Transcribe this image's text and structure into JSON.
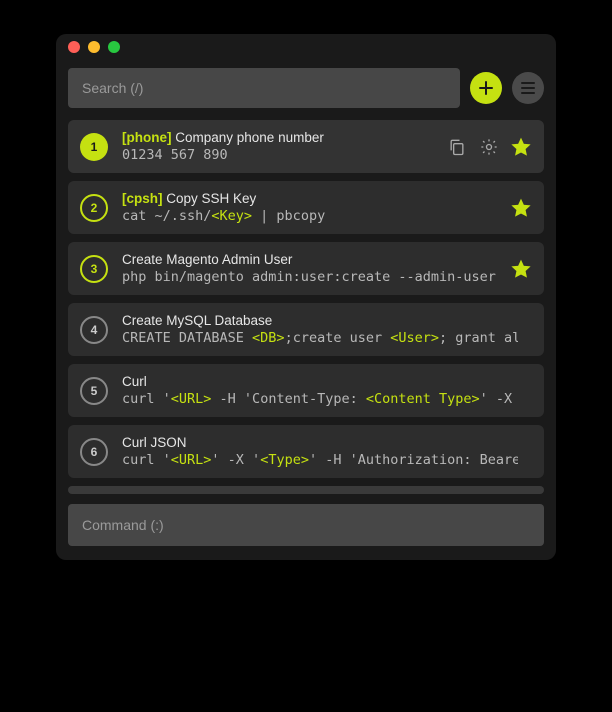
{
  "colors": {
    "accent": "#c5e111"
  },
  "search": {
    "placeholder": "Search (/)"
  },
  "command": {
    "placeholder": "Command (:)"
  },
  "items": [
    {
      "index": "1",
      "selected": true,
      "tag": "[phone]",
      "title": "Company phone number",
      "command": [
        {
          "t": "01234 567 890"
        }
      ],
      "starred": true,
      "showTools": true
    },
    {
      "index": "2",
      "selected": false,
      "tag": "[cpsh]",
      "title": "Copy SSH Key",
      "command": [
        {
          "t": "cat ~/.ssh/"
        },
        {
          "ph": "<Key>"
        },
        {
          "t": " | pbcopy"
        }
      ],
      "starred": true,
      "showTools": false
    },
    {
      "index": "3",
      "selected": false,
      "tag": "",
      "title": "Create Magento Admin User",
      "command": [
        {
          "t": "php bin/magento admin:user:create --admin-user="
        }
      ],
      "starred": true,
      "showTools": false
    },
    {
      "index": "4",
      "selected": false,
      "tag": "",
      "title": "Create MySQL Database",
      "command": [
        {
          "t": "CREATE DATABASE "
        },
        {
          "ph": "<DB>"
        },
        {
          "t": ";create user "
        },
        {
          "ph": "<User>"
        },
        {
          "t": "; grant all"
        }
      ],
      "starred": false,
      "showTools": false
    },
    {
      "index": "5",
      "selected": false,
      "tag": "",
      "title": "Curl",
      "command": [
        {
          "t": "curl '"
        },
        {
          "ph": "<URL>"
        },
        {
          "t": " -H 'Content-Type: "
        },
        {
          "ph": "<Content Type>"
        },
        {
          "t": "' -X"
        }
      ],
      "starred": false,
      "showTools": false
    },
    {
      "index": "6",
      "selected": false,
      "tag": "",
      "title": "Curl JSON",
      "command": [
        {
          "t": "curl '"
        },
        {
          "ph": "<URL>"
        },
        {
          "t": "' -X '"
        },
        {
          "ph": "<Type>"
        },
        {
          "t": "' -H 'Authorization: Bearer"
        }
      ],
      "starred": false,
      "showTools": false
    }
  ]
}
